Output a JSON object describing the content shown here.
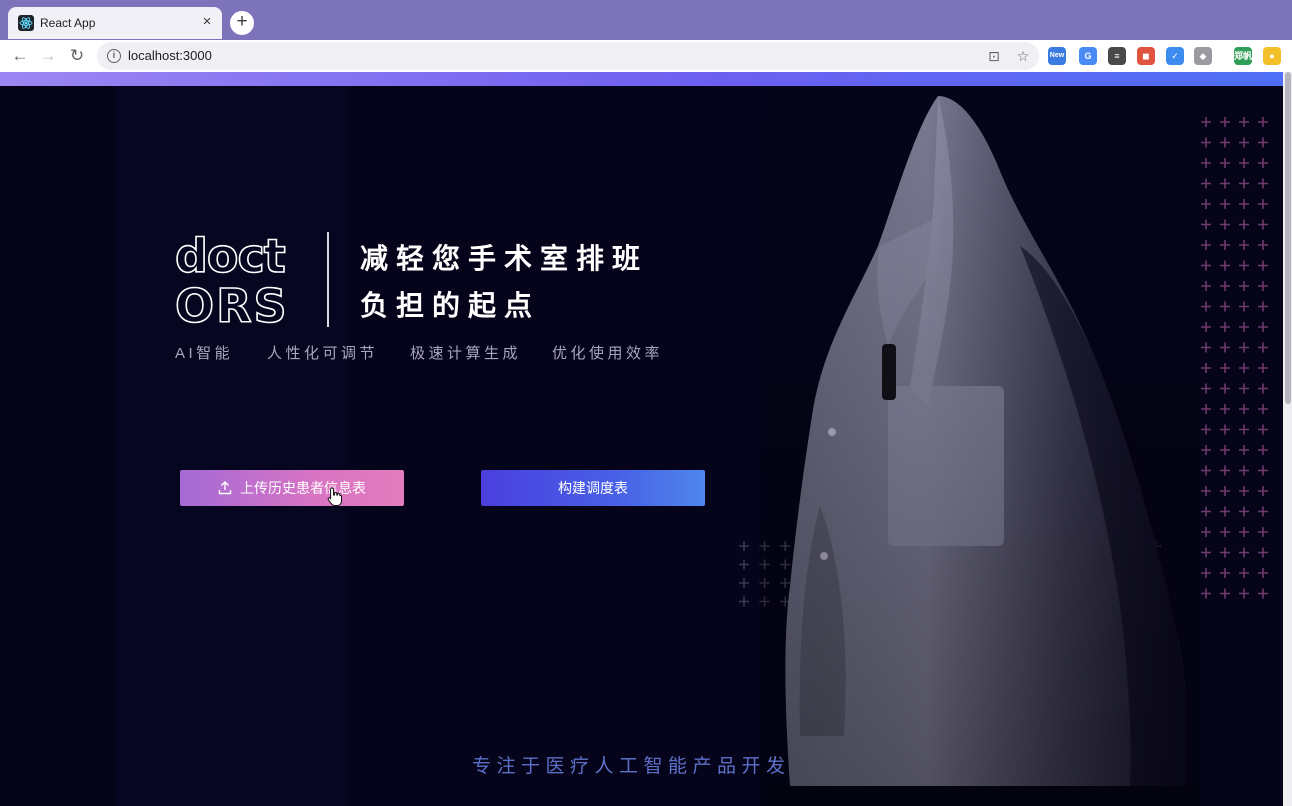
{
  "browser": {
    "tab_title": "React App",
    "tab_close": "×",
    "new_tab": "+",
    "url": "localhost:3000",
    "nav": {
      "back": "←",
      "forward": "→",
      "reload": "↻"
    },
    "omni_icons": {
      "translate": "⊡",
      "bookmark": "☆"
    },
    "extensions": [
      {
        "name": "new-extension-icon",
        "label": "New",
        "color": "#3a7be0"
      },
      {
        "name": "translate-extension-icon",
        "label": "G",
        "color": "#4a8af4"
      },
      {
        "name": "tools-extension-icon",
        "label": "≡",
        "color": "#4a4a4a"
      },
      {
        "name": "color-extension-icon",
        "label": "◼",
        "color": "#e0533e"
      },
      {
        "name": "check-extension-icon",
        "label": "✓",
        "color": "#3f8cf0"
      },
      {
        "name": "shield-extension-icon",
        "label": "◆",
        "color": "#9a9aa0"
      },
      {
        "name": "profile-extension-icon",
        "label": "郑帆",
        "color": "#2f9e57"
      },
      {
        "name": "update-extension-icon",
        "label": "●",
        "color": "#f4c02a"
      }
    ]
  },
  "hero": {
    "logo_line1": "doct",
    "logo_line2": "ORS",
    "headline_line1": "减轻您手术室排班",
    "headline_line2": "负担的起点",
    "features": [
      "AI智能",
      "人性化可调节",
      "极速计算生成",
      "优化使用效率"
    ]
  },
  "actions": {
    "upload_label": "上传历史患者信息表",
    "build_label": "构建调度表"
  },
  "footer": {
    "tagline": "专注于医疗人工智能产品开发"
  },
  "colors": {
    "page_bg": "#050419",
    "upload_gradient": [
      "#a46ad6",
      "#e27cbe"
    ],
    "build_gradient": [
      "#4a3fde",
      "#4f86ec"
    ],
    "tagline": "#5d70c9",
    "plus_purple": "#6e3a6b",
    "plus_gray": "#3a3950"
  }
}
